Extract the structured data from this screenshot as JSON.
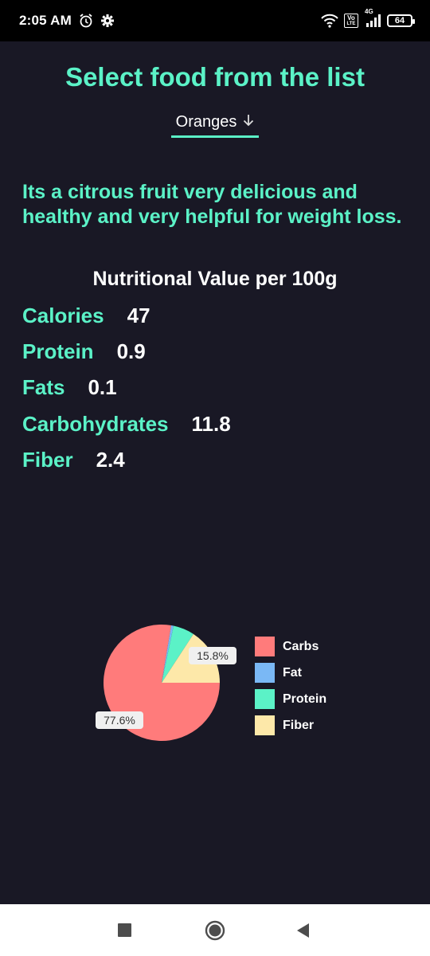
{
  "status_bar": {
    "time": "2:05 AM",
    "volte_top": "Vo",
    "volte_bottom": "LTE",
    "network": "4G",
    "battery": "64"
  },
  "page": {
    "title": "Select food from the list",
    "dropdown_value": "Oranges",
    "description": "Its a citrous fruit very delicious and healthy and very helpful for weight loss.",
    "nutrition_heading": "Nutritional Value per 100g"
  },
  "nutrients": [
    {
      "label": "Calories",
      "value": "47"
    },
    {
      "label": "Protein",
      "value": "0.9"
    },
    {
      "label": "Fats",
      "value": "0.1"
    },
    {
      "label": "Carbohydrates",
      "value": "11.8"
    },
    {
      "label": "Fiber",
      "value": "2.4"
    }
  ],
  "chart_data": {
    "type": "pie",
    "categories": [
      "Carbs",
      "Fat",
      "Protein",
      "Fiber"
    ],
    "values": [
      11.8,
      0.1,
      0.9,
      2.4
    ],
    "colors": [
      "#ff7b7b",
      "#7ab8f5",
      "#5bf2c7",
      "#fde8a9"
    ],
    "data_labels": [
      "77.6%",
      "",
      "",
      "15.8%"
    ],
    "legend_position": "right"
  },
  "colors": {
    "background": "#191825",
    "accent": "#5bf2c7"
  }
}
